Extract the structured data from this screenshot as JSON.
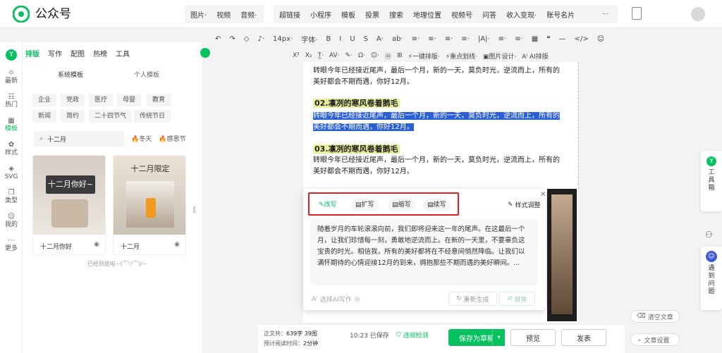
{
  "app": {
    "title": "公众号"
  },
  "topnav": {
    "group1": [
      "图片·",
      "视频",
      "音频·"
    ],
    "group2": [
      "超链接",
      "小程序",
      "模板",
      "投票",
      "搜索",
      "地理位置",
      "视频号",
      "问答",
      "收入变现·",
      "账号名片"
    ],
    "more": "···"
  },
  "toolbar1": [
    "↶",
    "↷",
    "◇",
    "♪·",
    "14px·",
    "字体·",
    "B",
    "I",
    "U",
    "S",
    "A·",
    "ab·",
    "≡·",
    "≡·",
    "≡·",
    "≡·",
    "|A|·",
    "≡·",
    "≡·",
    "▦",
    "❝",
    "—",
    "</>",
    "☺"
  ],
  "toolbar2": [
    "X²",
    "X₂",
    "T̲·",
    "AV·",
    "✎·",
    "Ω·",
    "☺·",
    "Ⓗ",
    "⊞",
    "⚡一键排版·",
    "⚡重点划线·",
    "▣图片设计·",
    "Aᴵ AI排版"
  ],
  "left_rail": [
    {
      "icon": "⟐",
      "label": "最新"
    },
    {
      "icon": "☷",
      "label": "热门"
    },
    {
      "icon": "▦",
      "label": "模板"
    },
    {
      "icon": "✿",
      "label": "样式"
    },
    {
      "icon": "◈",
      "label": "SVG"
    },
    {
      "icon": "❐",
      "label": "类型"
    },
    {
      "icon": "☺",
      "label": "我的"
    },
    {
      "icon": "⋯",
      "label": "更多"
    }
  ],
  "panel": {
    "tabs": [
      "排版",
      "写作",
      "配图",
      "热榜",
      "工具"
    ],
    "sub_tabs": [
      "系统模板",
      "个人模板"
    ],
    "chips_row1": [
      "企业",
      "党政",
      "医疗",
      "母婴",
      "教育"
    ],
    "chips_row2": [
      "新闻",
      "简约",
      "二十四节气",
      "传统节日"
    ],
    "search_value": "十二月",
    "hot_tags": [
      "冬天",
      "感恩节"
    ],
    "cards": [
      {
        "label": "十二月你好",
        "art": "十二月你好~"
      },
      {
        "label": "十二月",
        "art": "十二月限定"
      }
    ],
    "end_text": "已经到底啦~(⌒▽⌒)/~"
  },
  "editor": {
    "para1": "转眼今年已经接近尾声，最后一个月，新的一天，莫负时光，逆流而上，所有的美好都会不期而遇，你好12月。",
    "h2": "02.凛冽的寒风卷着鹅毛",
    "sel": "转眼今年已经接近尾声，最后一个月，新的一天，莫负时光，逆流而上，所有的美好都会不期而遇，你好12月。",
    "h3": "03.凛冽的寒风卷着鹅毛",
    "para2": "转眼今年已经接近尾声，最后一个月，新的一天，莫负时光，逆流而上，所有的美好都会不期而遇，你好12月。"
  },
  "ai": {
    "tabs": [
      "改写",
      "扩写",
      "缩写",
      "续写"
    ],
    "style": "样式调整",
    "text": "随着岁月的车轮滚滚向前，我们即将迎来这一年的尾声。在这最后一个月，让我们珍惜每一刻，勇敢地逆流而上。在新的一天里，不要辜负这宝贵的时光。相信我，所有的美好都将在不经意间悄然降临。让我们以满怀期待的心情迎接12月的到来，拥抱那些不期而遇的美好瞬间。...",
    "footer_label": "选择AI写作",
    "regenerate": "重新生成",
    "replace": "替换"
  },
  "bottom": {
    "word_label": "正文共：",
    "word_value": "639字 39图",
    "read_label": "预计阅读时间：",
    "read_value": "2分钟",
    "save_time": "10:23 已保存",
    "check": "违规检测",
    "save": "保存为草稿",
    "preview": "预览",
    "publish": "发表"
  },
  "right_dock": {
    "toolbox": "工具箱",
    "problem": "遇到问题"
  },
  "right_links": {
    "clear": "清空文章",
    "settings": "文章设置"
  },
  "colors": {
    "brand": "#07c160",
    "selection": "#2a5fd6",
    "highlight_red": "#e02020"
  }
}
